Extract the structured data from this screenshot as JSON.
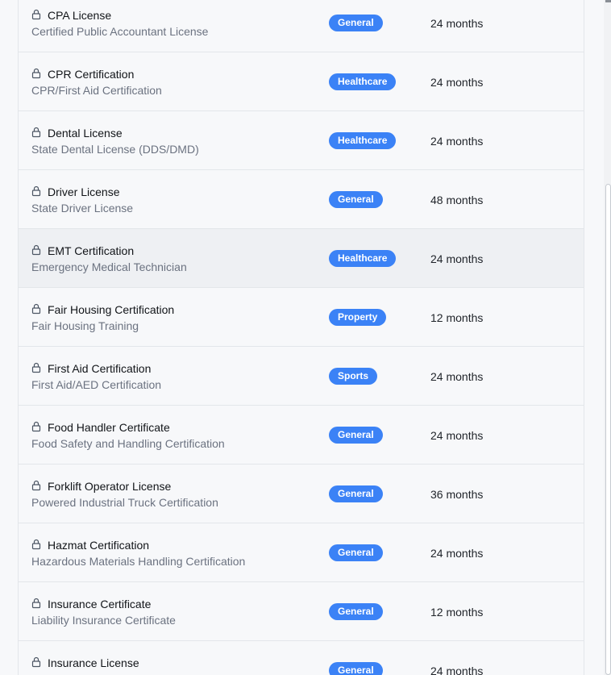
{
  "licenses": [
    {
      "name": "CPA License",
      "description": "Certified Public Accountant License",
      "category": "General",
      "period": "24 months"
    },
    {
      "name": "CPR Certification",
      "description": "CPR/First Aid Certification",
      "category": "Healthcare",
      "period": "24 months"
    },
    {
      "name": "Dental License",
      "description": "State Dental License (DDS/DMD)",
      "category": "Healthcare",
      "period": "24 months"
    },
    {
      "name": "Driver License",
      "description": "State Driver License",
      "category": "General",
      "period": "48 months"
    },
    {
      "name": "EMT Certification",
      "description": "Emergency Medical Technician",
      "category": "Healthcare",
      "period": "24 months"
    },
    {
      "name": "Fair Housing Certification",
      "description": "Fair Housing Training",
      "category": "Property",
      "period": "12 months"
    },
    {
      "name": "First Aid Certification",
      "description": "First Aid/AED Certification",
      "category": "Sports",
      "period": "24 months"
    },
    {
      "name": "Food Handler Certificate",
      "description": "Food Safety and Handling Certification",
      "category": "General",
      "period": "24 months"
    },
    {
      "name": "Forklift Operator License",
      "description": "Powered Industrial Truck Certification",
      "category": "General",
      "period": "36 months"
    },
    {
      "name": "Hazmat Certification",
      "description": "Hazardous Materials Handling Certification",
      "category": "General",
      "period": "24 months"
    },
    {
      "name": "Insurance Certificate",
      "description": "Liability Insurance Certificate",
      "category": "General",
      "period": "12 months"
    },
    {
      "name": "Insurance License",
      "description": "",
      "category": "General",
      "period": "24 months"
    }
  ],
  "colors": {
    "badge": "#3b82f6",
    "row_hover": "#eef0f3"
  },
  "icons": {
    "row_icon": "lock-icon"
  }
}
